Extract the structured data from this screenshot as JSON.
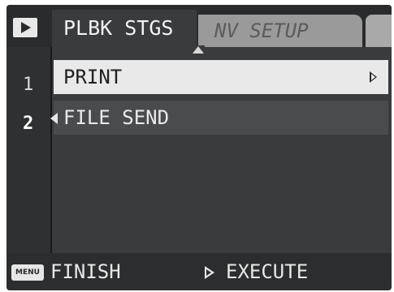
{
  "tabs": [
    {
      "label": "PLBK STGS",
      "active": true
    },
    {
      "label": "NV SETUP",
      "active": false
    }
  ],
  "menu": {
    "page_numbers": [
      "1",
      "2"
    ],
    "items": [
      {
        "label": "PRINT",
        "selected": true
      },
      {
        "label": "FILE SEND",
        "selected": false
      }
    ]
  },
  "footer": {
    "menu_key": "MENU",
    "finish_label": "FINISH",
    "execute_label": "EXECUTE"
  },
  "icons": [
    "play-icon",
    "up-arrow-icon",
    "chevron-right-icon",
    "chevron-left-icon",
    "menu-key-icon",
    "execute-arrow-icon"
  ],
  "colors": {
    "background": "#3a3b3d",
    "selected_row": "#e9e9e9",
    "inactive_tab": "#9a9a9a"
  }
}
